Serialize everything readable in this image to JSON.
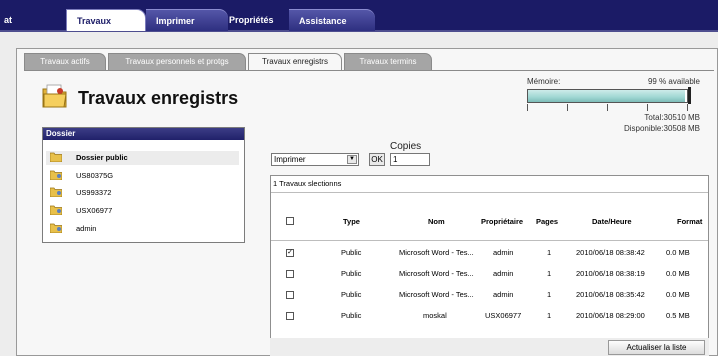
{
  "nav": {
    "tabs": [
      {
        "label": "at"
      },
      {
        "label": "Travaux"
      },
      {
        "label": "Imprimer"
      },
      {
        "label": "Propriétés"
      },
      {
        "label": "Assistance"
      }
    ],
    "active_tab": "Travaux"
  },
  "subtabs": [
    {
      "label": "Travaux actifs"
    },
    {
      "label": "Travaux personnels et protgs"
    },
    {
      "label": "Travaux enregistrs"
    },
    {
      "label": "Travaux termins"
    }
  ],
  "active_subtab": "Travaux enregistrs",
  "page_title": "Travaux enregistrs",
  "memory": {
    "label": "Mémoire:",
    "available": "99 % available",
    "available_fraction": 0.99,
    "total": "Total:30510 MB",
    "disponible": "Disponible:30508 MB"
  },
  "folder_panel": {
    "header": "Dossier",
    "items": [
      {
        "label": "Dossier public",
        "selected": true
      },
      {
        "label": "US80375G",
        "selected": false
      },
      {
        "label": "US993372",
        "selected": false
      },
      {
        "label": "USX06977",
        "selected": false
      },
      {
        "label": "admin",
        "selected": false
      }
    ]
  },
  "actions": {
    "action_value": "Imprimer",
    "ok_label": "OK",
    "copies_label": "Copies",
    "copies_value": "1"
  },
  "jobs_table": {
    "selection_count": "1 Travaux slectionns",
    "columns": [
      "Type",
      "Nom",
      "Propriétaire",
      "Pages",
      "Date/Heure",
      "Format"
    ],
    "rows": [
      {
        "checked": true,
        "type": "Public",
        "name": "Microsoft Word - Tes...",
        "owner": "admin",
        "pages": "1",
        "datetime": "2010/06/18 08:38:42",
        "size": "0.0 MB"
      },
      {
        "checked": false,
        "type": "Public",
        "name": "Microsoft Word - Tes...",
        "owner": "admin",
        "pages": "1",
        "datetime": "2010/06/18 08:38:19",
        "size": "0.0 MB"
      },
      {
        "checked": false,
        "type": "Public",
        "name": "Microsoft Word - Tes...",
        "owner": "admin",
        "pages": "1",
        "datetime": "2010/06/18 08:35:42",
        "size": "0.0 MB"
      },
      {
        "checked": false,
        "type": "Public",
        "name": "moskal",
        "owner": "USX06977",
        "pages": "1",
        "datetime": "2010/06/18 08:29:00",
        "size": "0.5 MB"
      }
    ]
  },
  "refresh_label": "Actualiser la liste",
  "colors": {
    "nav_bar": "#1b1b66",
    "folder_header": "#2a2b74",
    "memory_fill": "#9fd7d3",
    "subtab_inactive": "#a5a5a5"
  }
}
